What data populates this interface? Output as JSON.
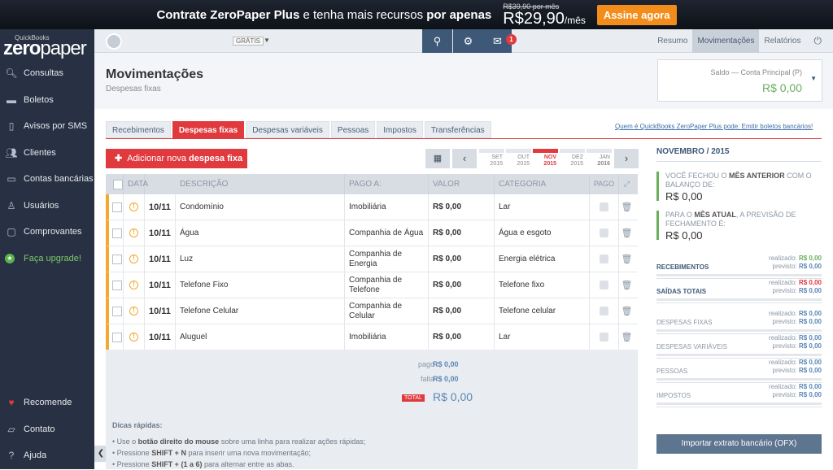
{
  "banner": {
    "text_pre": "Contrate ZeroPaper Plus",
    "text_mid": " e tenha mais recursos ",
    "text_post": "por apenas",
    "old_price": "R$39,90 por mês",
    "new_price": "R$29,90",
    "per": "/mês",
    "cta": "Assine agora"
  },
  "logo": {
    "top": "QuickBooks",
    "zero": "zero",
    "paper": "paper"
  },
  "sidebar": {
    "items": [
      {
        "label": "Consultas",
        "icon": "search-doc-icon"
      },
      {
        "label": "Boletos",
        "icon": "barcode-icon"
      },
      {
        "label": "Avisos por SMS",
        "icon": "phone-icon"
      },
      {
        "label": "Clientes",
        "icon": "users-icon"
      },
      {
        "label": "Contas bancárias",
        "icon": "bank-icon"
      },
      {
        "label": "Usuários",
        "icon": "user-icon"
      },
      {
        "label": "Comprovantes",
        "icon": "file-icon"
      },
      {
        "label": "Faça upgrade!",
        "icon": "star-icon"
      }
    ],
    "bottom": [
      {
        "label": "Recomende",
        "icon": "heart-icon"
      },
      {
        "label": "Contato",
        "icon": "chat-icon"
      },
      {
        "label": "Ajuda",
        "icon": "help-icon"
      }
    ]
  },
  "topbar": {
    "plan": "GRÁTIS",
    "notifications": "1",
    "nav": [
      "Resumo",
      "Movimentações",
      "Relatórios"
    ]
  },
  "page": {
    "title": "Movimentações",
    "subtitle": "Despesas fixas",
    "saldo_label": "Saldo — Conta Principal (P)",
    "saldo_value": "R$ 0,00"
  },
  "tabs": [
    "Recebimentos",
    "Despesas fixas",
    "Despesas variáveis",
    "Pessoas",
    "Impostos",
    "Transferências"
  ],
  "promo_link": "Quem é QuickBooks ZeroPaper Plus pode: Emitir boletos bancários!",
  "add_button": {
    "pre": "Adicionar nova ",
    "bold": "despesa fixa"
  },
  "months": [
    {
      "m": "SET",
      "y": "2015"
    },
    {
      "m": "OUT",
      "y": "2015"
    },
    {
      "m": "NOV",
      "y": "2015"
    },
    {
      "m": "DEZ",
      "y": "2015"
    },
    {
      "m": "JAN",
      "y": "2016"
    }
  ],
  "table": {
    "headers": [
      "DATA",
      "DESCRIÇÃO",
      "PAGO A:",
      "VALOR",
      "CATEGORIA",
      "PAGO"
    ],
    "rows": [
      {
        "date": "10/11",
        "desc": "Condomínio",
        "payee": "Imobiliária",
        "value": "R$ 0,00",
        "category": "Lar"
      },
      {
        "date": "10/11",
        "desc": "Água",
        "payee": "Companhia de Água",
        "value": "R$ 0,00",
        "category": "Água e esgoto"
      },
      {
        "date": "10/11",
        "desc": "Luz",
        "payee": "Companhia de Energia",
        "value": "R$ 0,00",
        "category": "Energia elétrica"
      },
      {
        "date": "10/11",
        "desc": "Telefone Fixo",
        "payee": "Companhia de Telefone",
        "value": "R$ 0,00",
        "category": "Telefone fixo"
      },
      {
        "date": "10/11",
        "desc": "Telefone Celular",
        "payee": "Companhia de Celular",
        "value": "R$ 0,00",
        "category": "Telefone celular"
      },
      {
        "date": "10/11",
        "desc": "Aluguel",
        "payee": "Imobiliária",
        "value": "R$ 0,00",
        "category": "Lar"
      }
    ]
  },
  "summary": {
    "pago_label": "pago",
    "pago_value": "R$ 0,00",
    "falta_label": "falta",
    "falta_value": "R$ 0,00",
    "total_label": "TOTAL",
    "total_value": "R$ 0,00"
  },
  "tips": {
    "title": "Dicas rápidas:",
    "t1_pre": "• Use o ",
    "t1_b": "botão direito do mouse",
    "t1_post": " sobre uma linha para realizar ações rápidas;",
    "t2_pre": "• Pressione ",
    "t2_b": "SHIFT + N",
    "t2_post": " para inserir uma nova movimentação;",
    "t3_pre": "• Pressione ",
    "t3_b": "SHIFT + (1 a 6)",
    "t3_post": " para alternar entre as abas."
  },
  "right": {
    "title": "NOVEMBRO / 2015",
    "box1_pre": "VOCÊ FECHOU O ",
    "box1_b": "MÊS ANTERIOR",
    "box1_post": " COM O BALANÇO DE:",
    "box1_value": "R$ 0,00",
    "box2_pre": "PARA O ",
    "box2_b": "MÊS ATUAL",
    "box2_post": ", A PREVISÃO DE FECHAMENTO É:",
    "box2_value": "R$ 0,00",
    "realizado": "realizado:",
    "previsto": "previsto:",
    "stats": [
      {
        "name": "RECEBIMENTOS",
        "realizado": "R$ 0,00",
        "previsto": "R$ 0,00"
      },
      {
        "name": "SAÍDAS TOTAIS",
        "realizado": "R$ 0,00",
        "previsto": "R$ 0,00"
      },
      {
        "name": "DESPESAS FIXAS",
        "realizado": "R$ 0,00",
        "previsto": "R$ 0,00"
      },
      {
        "name": "DESPESAS VARIÁVEIS",
        "realizado": "R$ 0,00",
        "previsto": "R$ 0,00"
      },
      {
        "name": "PESSOAS",
        "realizado": "R$ 0,00",
        "previsto": "R$ 0,00"
      },
      {
        "name": "IMPOSTOS",
        "realizado": "R$ 0,00",
        "previsto": "R$ 0,00"
      }
    ],
    "ofx_button": "Importar extrato bancário (OFX)"
  }
}
